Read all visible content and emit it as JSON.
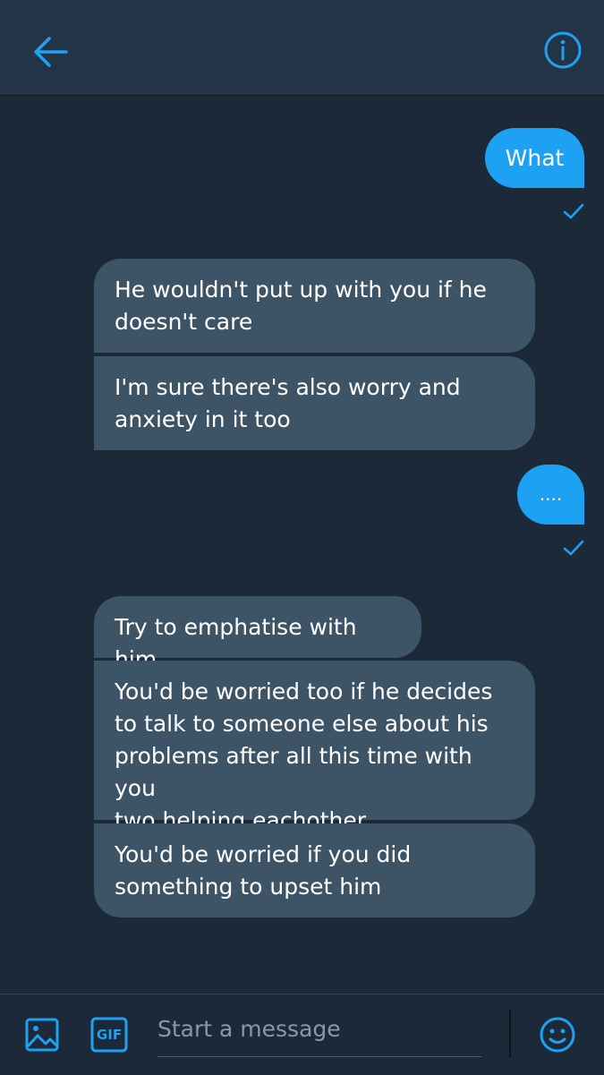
{
  "header": {
    "back_icon": "arrow-left-icon",
    "info_icon": "info-icon"
  },
  "messages": [
    {
      "direction": "sent",
      "text": "What"
    },
    {
      "direction": "received",
      "lines": [
        "He wouldn't put up with you if he",
        "doesn't care"
      ]
    },
    {
      "direction": "received",
      "lines": [
        "I'm sure there's also worry and",
        "anxiety in it too"
      ]
    },
    {
      "direction": "sent",
      "text": "...."
    },
    {
      "direction": "received",
      "lines": [
        "Try to emphatise with him"
      ]
    },
    {
      "direction": "received",
      "lines": [
        "You'd be worried too if he decides",
        "to talk to someone else about his",
        "problems after all this time with you",
        "two helping eachother"
      ]
    },
    {
      "direction": "received",
      "lines": [
        "You'd be worried if you did",
        "something to upset him"
      ]
    }
  ],
  "composer": {
    "placeholder": "Start a message",
    "gif_label": "GIF",
    "image_icon": "image-icon",
    "emoji_icon": "emoji-icon"
  },
  "colors": {
    "accent": "#1da1f2",
    "background": "#1c2938",
    "header": "#243447",
    "received_bubble": "#3d5466"
  }
}
